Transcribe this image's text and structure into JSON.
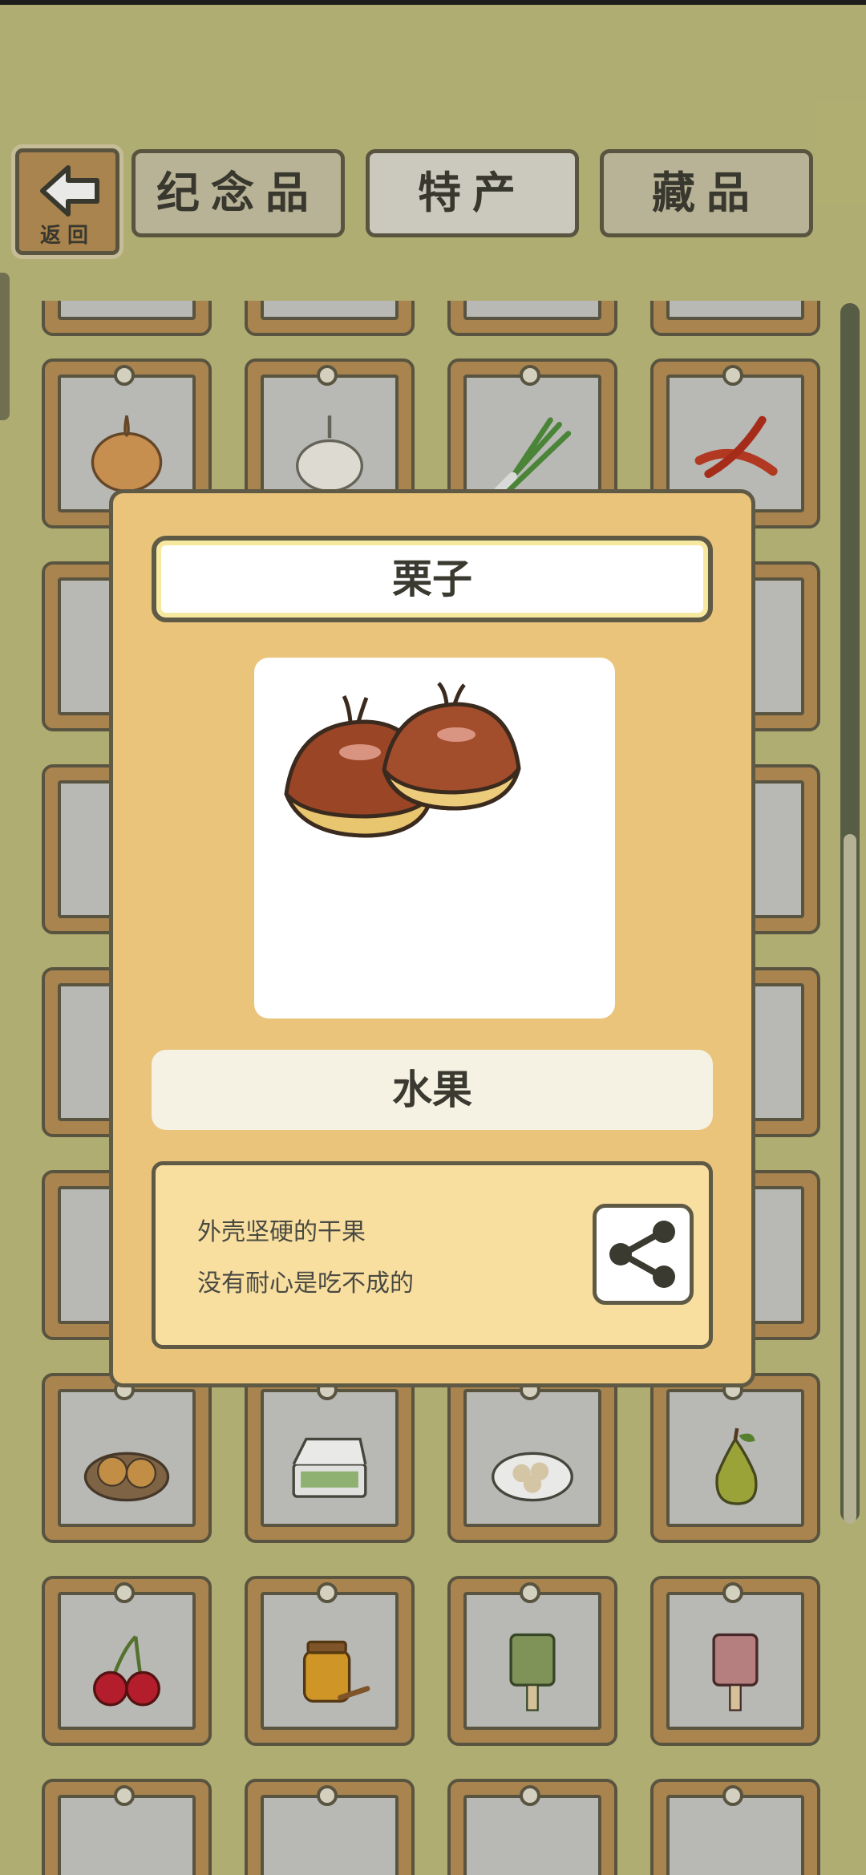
{
  "header": {
    "back_label": "返回",
    "tabs": [
      {
        "label": "纪念品",
        "active": false
      },
      {
        "label": "特产",
        "active": true
      },
      {
        "label": "藏品",
        "active": false
      }
    ]
  },
  "grid_items": [
    {
      "icon": "onion-icon"
    },
    {
      "icon": "garlic-icon"
    },
    {
      "icon": "scallion-icon"
    },
    {
      "icon": "chili-pepper-icon"
    },
    {
      "icon": "pastry-icon"
    },
    {
      "icon": "bento-box-icon"
    },
    {
      "icon": "dumplings-plate-icon"
    },
    {
      "icon": "pear-icon"
    },
    {
      "icon": "cherries-icon"
    },
    {
      "icon": "honey-jar-icon"
    },
    {
      "icon": "bronze-mask-green-icon"
    },
    {
      "icon": "bronze-mask-pink-icon"
    }
  ],
  "detail": {
    "title": "栗子",
    "image_icon": "chestnut-icon",
    "category": "水果",
    "description_lines": [
      "外壳坚硬的干果",
      "没有耐心是吃不成的"
    ]
  },
  "colors": {
    "background": "#c0bd7c",
    "frame_wood": "#b98f55",
    "outline": "#5f5a45",
    "modal": "#e9c47a"
  }
}
